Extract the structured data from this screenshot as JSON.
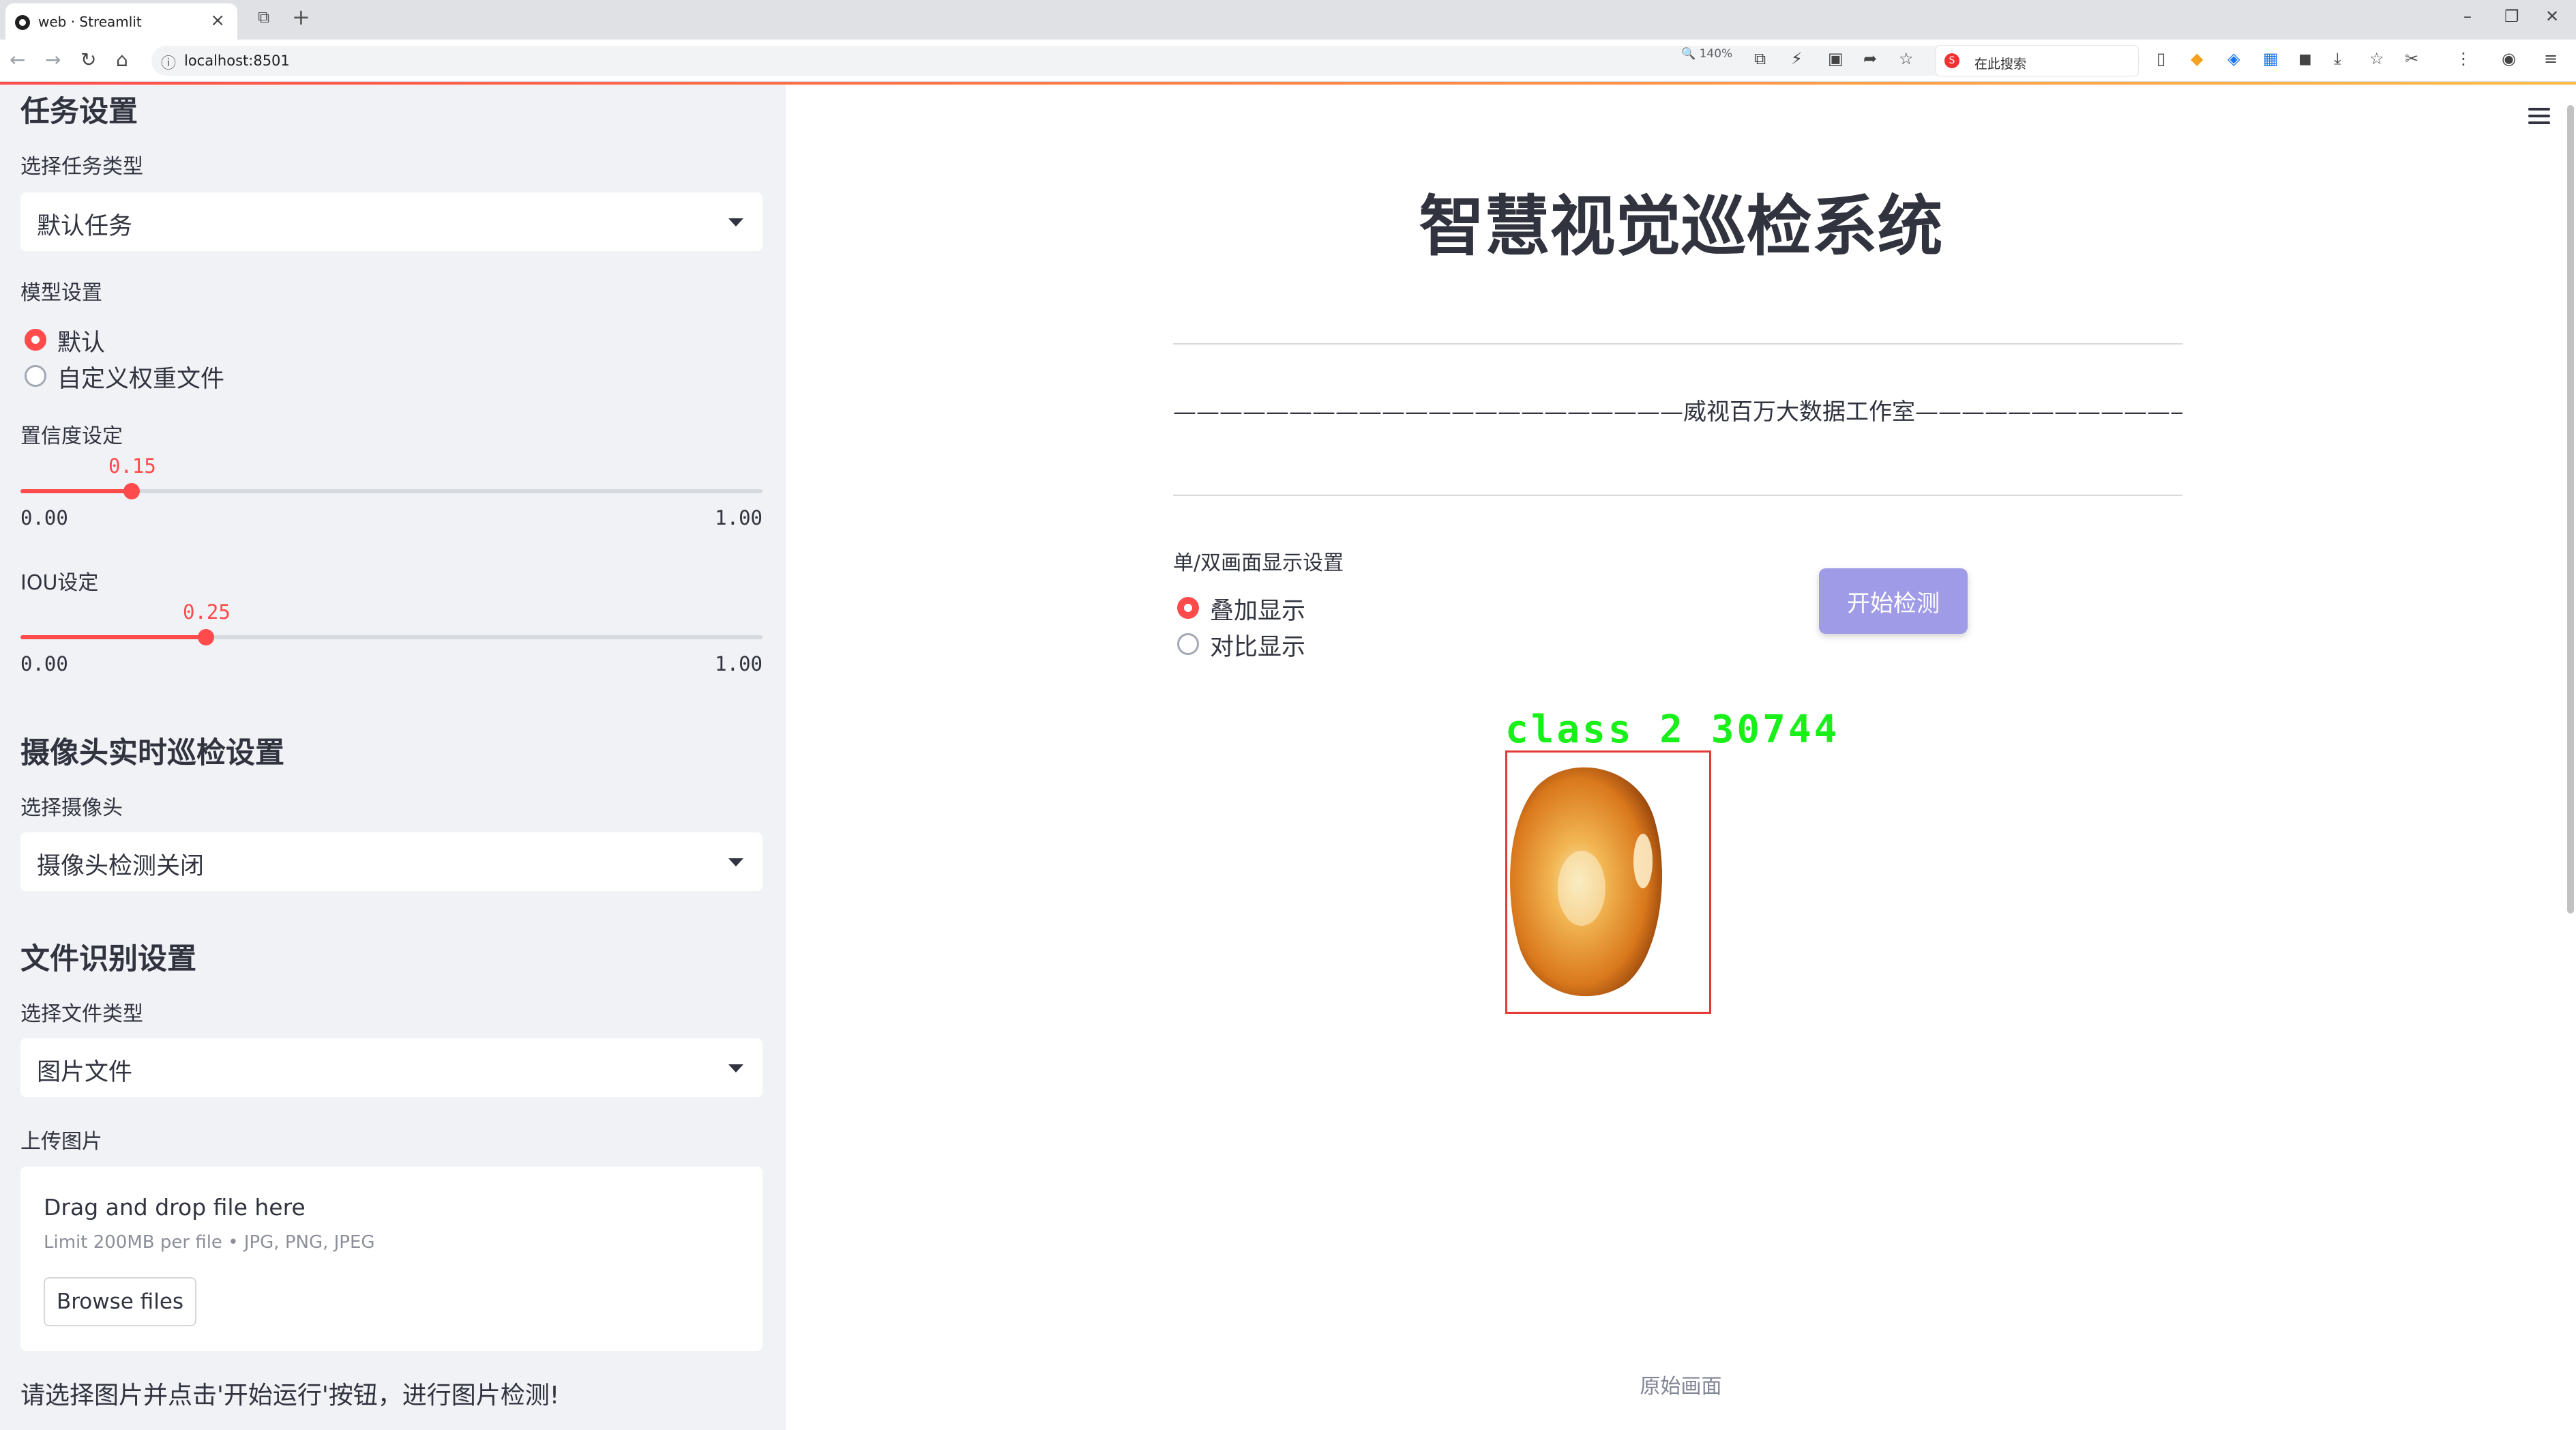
{
  "browser": {
    "tab_title": "web · Streamlit",
    "url": "localhost:8501",
    "zoom": "140%",
    "search_placeholder": "在此搜索"
  },
  "sidebar": {
    "task_section": {
      "heading": "任务设置",
      "select_label": "选择任务类型",
      "select_value": "默认任务"
    },
    "model_section": {
      "label": "模型设置",
      "options": [
        "默认",
        "自定义权重文件"
      ],
      "selected": "默认"
    },
    "confidence": {
      "label": "置信度设定",
      "value": "0.15",
      "value_fraction": 0.15,
      "min": "0.00",
      "max": "1.00"
    },
    "iou": {
      "label": "IOU设定",
      "value": "0.25",
      "value_fraction": 0.25,
      "min": "0.00",
      "max": "1.00"
    },
    "camera_section": {
      "heading": "摄像头实时巡检设置",
      "select_label": "选择摄像头",
      "select_value": "摄像头检测关闭"
    },
    "file_section": {
      "heading": "文件识别设置",
      "select_label": "选择文件类型",
      "select_value": "图片文件",
      "upload_label": "上传图片",
      "drop_title": "Drag and drop file here",
      "drop_limit": "Limit 200MB per file • JPG, PNG, JPEG",
      "browse_button": "Browse files"
    },
    "bottom_message": "请选择图片并点击'开始运行'按钮，进行图片检测!"
  },
  "main": {
    "title": "智慧视觉巡检系统",
    "studio_line": "——————————————————————威视百万大数据工作室————————————————————————",
    "display_label": "单/双画面显示设置",
    "display_options": [
      "叠加显示",
      "对比显示"
    ],
    "display_selected": "叠加显示",
    "start_button": "开始检测",
    "detection_label": "class 2 30744",
    "caption": "原始画面"
  },
  "colors": {
    "accent": "#ff4b4b",
    "button": "#9f9be6",
    "sidebar_bg": "#f0f2f6",
    "detection_text": "#19f019",
    "detection_box": "#e53935"
  },
  "icons": [
    "back-icon",
    "forward-icon",
    "reload-icon",
    "home-icon",
    "menu-icon"
  ]
}
